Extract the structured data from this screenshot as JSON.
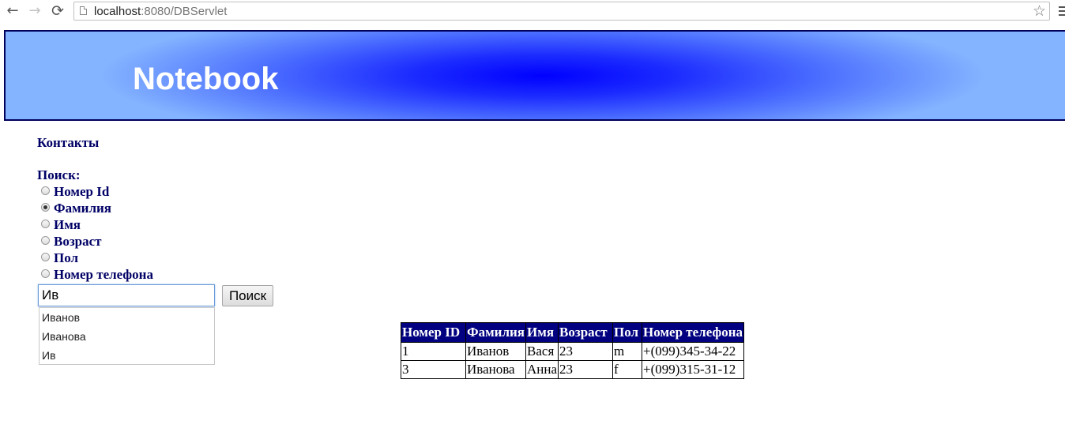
{
  "browser": {
    "url_host": "localhost",
    "url_path": ":8080/DBServlet",
    "icons": {
      "back": "arrow-left-icon",
      "forward": "arrow-right-icon",
      "reload": "reload-icon",
      "page": "page-icon",
      "bookmark": "star-icon",
      "menu": "menu-icon"
    }
  },
  "header": {
    "title": "Notebook",
    "colors": {
      "center": "#0000ff",
      "edge": "#84b4ff",
      "border": "#00005a"
    }
  },
  "contacts_title": "Контакты",
  "search": {
    "label": "Поиск:",
    "options": [
      {
        "label": "Номер Id",
        "checked": false
      },
      {
        "label": "Фамилия",
        "checked": true
      },
      {
        "label": "Имя",
        "checked": false
      },
      {
        "label": "Возраст",
        "checked": false
      },
      {
        "label": "Пол",
        "checked": false
      },
      {
        "label": "Номер телефона",
        "checked": false
      }
    ],
    "input_value": "Ив",
    "button_label": "Поиск",
    "suggestions": [
      "Иванов",
      "Иванова",
      "Ив"
    ]
  },
  "table": {
    "headers": [
      "Номер ID",
      "Фамилия",
      "Имя",
      "Возраст",
      "Пол",
      "Номер телефона"
    ],
    "rows": [
      [
        "1",
        "Иванов",
        "Вася",
        "23",
        "m",
        "+(099)345-34-22"
      ],
      [
        "3",
        "Иванова",
        "Анна",
        "23",
        "f",
        "+(099)315-31-12"
      ]
    ],
    "header_color": "#000080"
  }
}
